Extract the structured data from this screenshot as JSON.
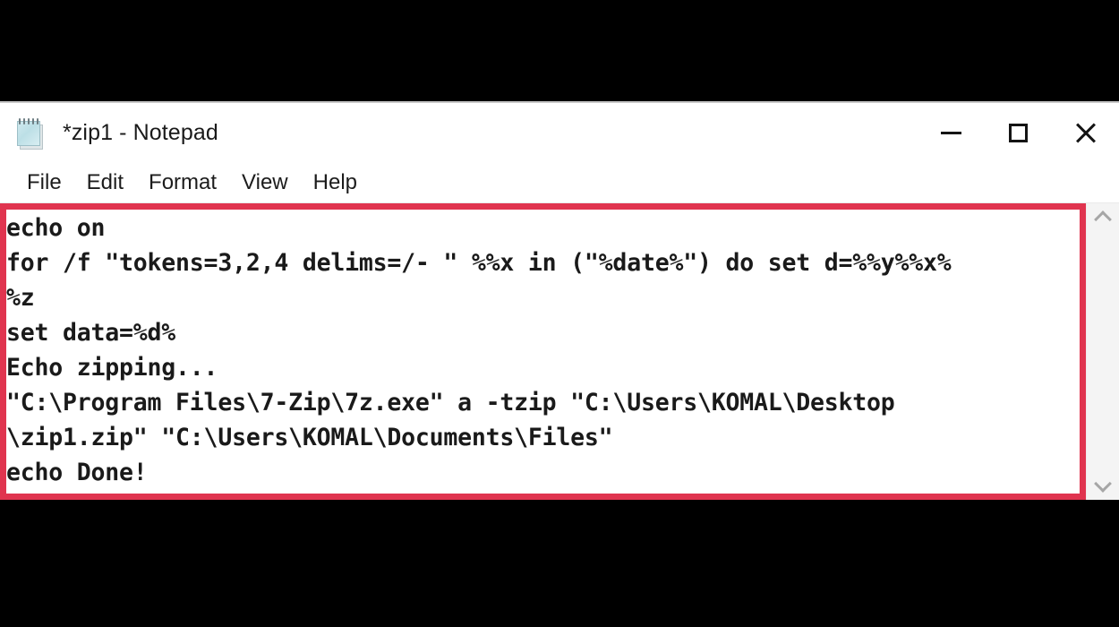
{
  "window": {
    "title": "*zip1 - Notepad",
    "icon": "notepad-icon",
    "controls": {
      "minimize": "–",
      "maximize": "□",
      "close": "✕"
    }
  },
  "menu": {
    "items": [
      {
        "label": "File"
      },
      {
        "label": "Edit"
      },
      {
        "label": "Format"
      },
      {
        "label": "View"
      },
      {
        "label": "Help"
      }
    ]
  },
  "editor": {
    "content": "echo on\nfor /f \"tokens=3,2,4 delims=/- \" %%x in (\"%date%\") do set d=%%y%%x%%z\nset data=%d%\nEcho zipping...\n\"C:\\Program Files\\7-Zip\\7z.exe\" a -tzip \"C:\\Users\\KOMAL\\Desktop\\zip1.zip\" \"C:\\Users\\KOMAL\\Documents\\Files\"\necho Done!",
    "rendered_lines": [
      "echo on",
      "for /f \"tokens=3,2,4 delims=/- \" %%x in (\"%date%\") do set d=%%y%%x%",
      "%z",
      "set data=%d%",
      "Echo zipping...",
      "\"C:\\Program Files\\7-Zip\\7z.exe\" a -tzip \"C:\\Users\\KOMAL\\Desktop",
      "\\zip1.zip\" \"C:\\Users\\KOMAL\\Documents\\Files\"",
      "echo Done!"
    ],
    "word_wrap": "on"
  },
  "scrollbar": {
    "up_arrow": "scroll-up-icon",
    "down_arrow": "scroll-down-icon"
  },
  "annotation": {
    "highlight_color": "#e0344f",
    "shape": "rectangle"
  },
  "colors": {
    "window_background": "#ffffff",
    "text": "#1a1a1a",
    "highlight_red": "#e0344f",
    "letterbox": "#000000",
    "scrollbar_track": "#f4f4f4",
    "scrollbar_arrow": "#a6a6a6"
  }
}
